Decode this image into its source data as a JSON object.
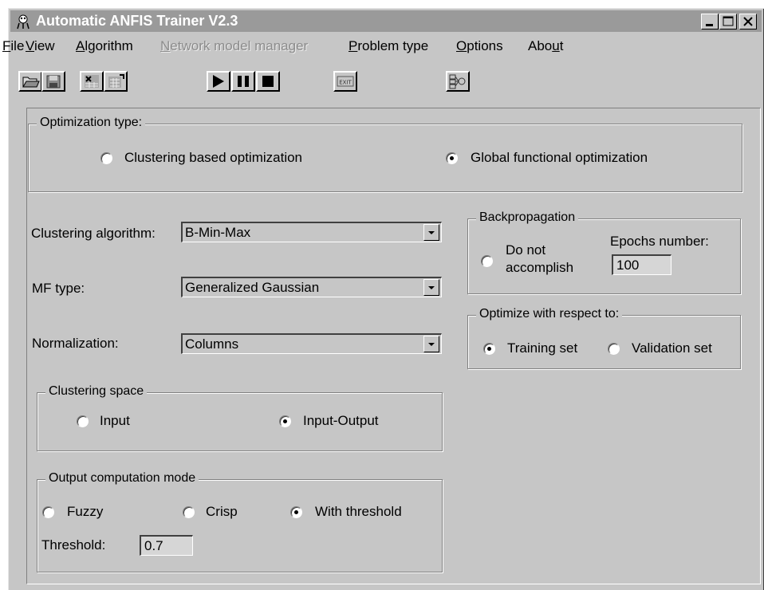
{
  "window": {
    "title": "Automatic ANFIS Trainer V2.3"
  },
  "menu": {
    "file": "File",
    "view": "View",
    "algorithm": "Algorithm",
    "network_model_manager": "Network model manager",
    "problem_type": "Problem type",
    "options": "Options",
    "about": "About"
  },
  "toolbar": {
    "exit_label": "EXIT"
  },
  "optimization_type": {
    "legend": "Optimization type:",
    "clustering_based": "Clustering based optimization",
    "global_functional": "Global functional optimization",
    "selected": "global_functional"
  },
  "clustering_algorithm": {
    "label": "Clustering algorithm:",
    "value": "B-Min-Max"
  },
  "mf_type": {
    "label": "MF type:",
    "value": "Generalized Gaussian"
  },
  "normalization": {
    "label": "Normalization:",
    "value": "Columns"
  },
  "clustering_space": {
    "legend": "Clustering space",
    "input": "Input",
    "input_output": "Input-Output",
    "selected": "input_output"
  },
  "output_computation": {
    "legend": "Output computation mode",
    "fuzzy": "Fuzzy",
    "crisp": "Crisp",
    "with_threshold": "With threshold",
    "selected": "with_threshold",
    "threshold_label": "Threshold:",
    "threshold_value": "0.7"
  },
  "backpropagation": {
    "legend": "Backpropagation",
    "do_not_line1": "Do not",
    "do_not_line2": "accomplish",
    "epochs_label": "Epochs number:",
    "epochs_value": "100"
  },
  "optimize_wrt": {
    "legend": "Optimize with respect to:",
    "training_set": "Training set",
    "validation_set": "Validation set",
    "selected": "training_set"
  }
}
